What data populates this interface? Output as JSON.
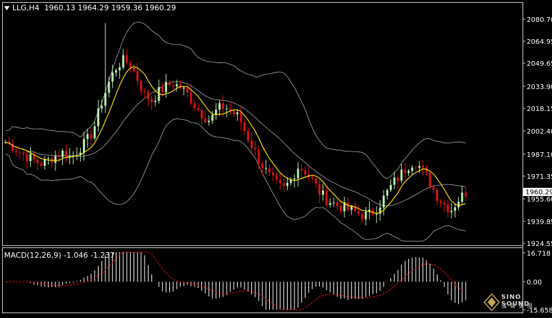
{
  "header": {
    "symbol_tf": "LLG,H4",
    "ohlc": "1960.13 1964.29 1959.36 1960.29"
  },
  "price_axis": {
    "ticks": [
      "2080.70",
      "2064.95",
      "2049.65",
      "2033.90",
      "2018.15",
      "2002.40",
      "1987.10",
      "1971.35",
      "1955.60",
      "1939.85",
      "1924.55"
    ],
    "current_price": "1960.29"
  },
  "macd": {
    "label": "MACD(12,26,9) -1.046 -1.237",
    "ticks": [
      "16.718",
      "0.00",
      "-15.658"
    ]
  },
  "logo": {
    "line1": "SINO SOUND",
    "line2": "漢 聲 集 團"
  },
  "colors": {
    "background": "#000000",
    "bull_candle": "#b8f0b0",
    "bear_candle": "#e01010",
    "ma_line": "#ffe000",
    "band_line": "#9a9a9a",
    "macd_hist": "#ffffff",
    "signal_line": "#e01010",
    "current_price_box": "#ffffff"
  },
  "chart_data": {
    "type": "candlestick",
    "title": "LLG,H4",
    "price_range": [
      1924.55,
      2085.0
    ],
    "candles_close_estimate": [
      1995,
      1992,
      1988,
      1985,
      1982,
      1980,
      1983,
      1986,
      1988,
      1984,
      1990,
      1995,
      2003,
      2020,
      2035,
      2046,
      2052,
      2050,
      2040,
      2028,
      2024,
      2030,
      2034,
      2036,
      2033,
      2028,
      2020,
      2014,
      2010,
      2018,
      2020,
      2016,
      2012,
      2000,
      1990,
      1980,
      1972,
      1966,
      1962,
      1968,
      1978,
      1975,
      1968,
      1960,
      1955,
      1952,
      1950,
      1948,
      1946,
      1944,
      1945,
      1950,
      1958,
      1966,
      1972,
      1978,
      1982,
      1976,
      1968,
      1958,
      1952,
      1948,
      1955,
      1960
    ],
    "macd_range": [
      -15.658,
      16.718
    ],
    "current_price": 1960.29
  }
}
